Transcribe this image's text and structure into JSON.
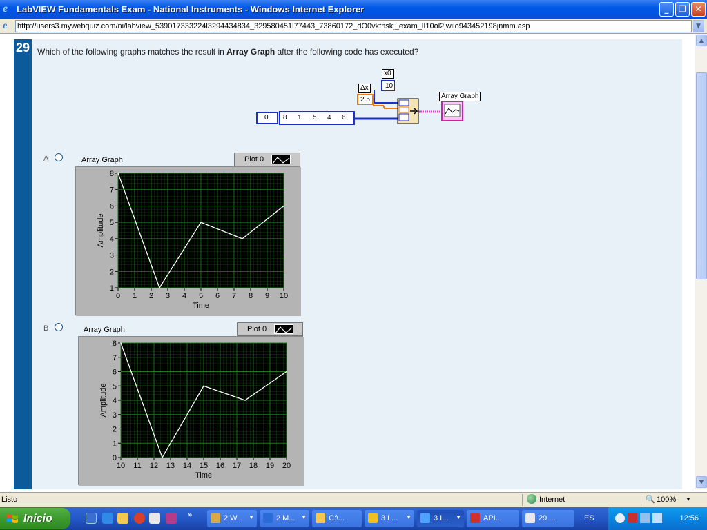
{
  "window": {
    "title": "LabVIEW Fundamentals Exam - National Instruments - Windows Internet Explorer",
    "url": "http://users3.mywebquiz.com/ni/labview_539017333224l3294434834_329580451l77443_73860172_dO0vkfnskj_exam_lI10ol2jwilo943452198jnmm.asp"
  },
  "question": {
    "number": "29",
    "text_before": "Which of the following graphs matches the result in ",
    "text_bold": "Array Graph",
    "text_after": " after the following code has executed?"
  },
  "block_diagram": {
    "x0_label": "x0",
    "x0_value": "10",
    "dx_label": "Δx",
    "dx_value": "2.5",
    "index_value": "0",
    "array_values": [
      "8",
      "1",
      "5",
      "4",
      "6"
    ],
    "indicator_label": "Array Graph"
  },
  "options": [
    {
      "letter": "A",
      "graph_title": "Array Graph",
      "legend_label": "Plot 0",
      "chart_data": {
        "type": "line",
        "x": [
          0,
          2.5,
          5,
          7.5,
          10
        ],
        "y": [
          8,
          1,
          5,
          4,
          6
        ],
        "xlabel": "Time",
        "ylabel": "Amplitude",
        "xlim": [
          0,
          10
        ],
        "ylim": [
          1,
          8
        ],
        "xticks": [
          "0",
          "1",
          "2",
          "3",
          "4",
          "5",
          "6",
          "7",
          "8",
          "9",
          "10"
        ],
        "yticks": [
          "1",
          "2",
          "3",
          "4",
          "5",
          "6",
          "7",
          "8"
        ],
        "grid": true,
        "line_color": "#ffffff",
        "bg_color": "#000000",
        "grid_color": "#1f7a1f"
      }
    },
    {
      "letter": "B",
      "graph_title": "Array Graph",
      "legend_label": "Plot 0",
      "chart_data": {
        "type": "line",
        "x": [
          10,
          12.5,
          15,
          17.5,
          20
        ],
        "y": [
          8,
          0,
          5,
          4,
          6
        ],
        "xlabel": "Time",
        "ylabel": "Amplitude",
        "xlim": [
          10,
          20
        ],
        "ylim": [
          0,
          8
        ],
        "xticks": [
          "10",
          "11",
          "12",
          "13",
          "14",
          "15",
          "16",
          "17",
          "18",
          "19",
          "20"
        ],
        "yticks": [
          "0",
          "1",
          "2",
          "3",
          "4",
          "5",
          "6",
          "7",
          "8"
        ],
        "grid": true,
        "line_color": "#ffffff",
        "bg_color": "#000000",
        "grid_color": "#1f7a1f"
      }
    }
  ],
  "statusbar": {
    "status": "Listo",
    "zone": "Internet",
    "zoom": "100%"
  },
  "taskbar": {
    "start_label": "Inicio",
    "tasks": [
      "2 W...",
      "2 M...",
      "C:\\...",
      "3 L...",
      "3 I...",
      "API...",
      "29...."
    ],
    "language": "ES",
    "time": "12:56"
  }
}
